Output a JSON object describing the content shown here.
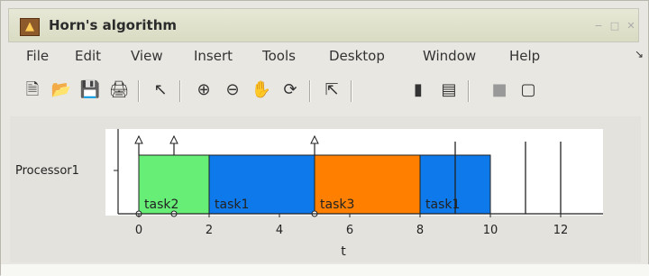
{
  "window": {
    "title": "Horn's algorithm"
  },
  "menubar": {
    "items": [
      {
        "label": "File"
      },
      {
        "label": "Edit"
      },
      {
        "label": "View"
      },
      {
        "label": "Insert"
      },
      {
        "label": "Tools"
      },
      {
        "label": "Desktop"
      },
      {
        "label": "Window"
      },
      {
        "label": "Help"
      }
    ]
  },
  "toolbar": {
    "icons": [
      "new-file-icon",
      "open-folder-icon",
      "save-icon",
      "print-icon",
      "pointer-icon",
      "zoom-in-icon",
      "zoom-out-icon",
      "pan-hand-icon",
      "rotate-3d-icon",
      "data-cursor-icon",
      "colorbar-icon",
      "legend-icon",
      "hide-plot-tools-icon",
      "show-plot-tools-icon"
    ]
  },
  "chart_data": {
    "type": "gantt",
    "y_category": "Processor1",
    "xlabel": "t",
    "xlim": [
      -0.5,
      13
    ],
    "xticks": [
      0,
      2,
      4,
      6,
      8,
      10,
      12
    ],
    "tasks": [
      {
        "name": "task2",
        "start": 0,
        "end": 2,
        "color": "#66ee77"
      },
      {
        "name": "task1",
        "start": 2,
        "end": 5,
        "color": "#0d79ea"
      },
      {
        "name": "task3",
        "start": 5,
        "end": 8,
        "color": "#ff8000"
      },
      {
        "name": "task1",
        "start": 8,
        "end": 10,
        "color": "#0d79ea"
      }
    ],
    "arrival_markers": [
      0,
      1,
      5
    ],
    "deadline_lines": [
      9,
      11,
      12
    ]
  }
}
